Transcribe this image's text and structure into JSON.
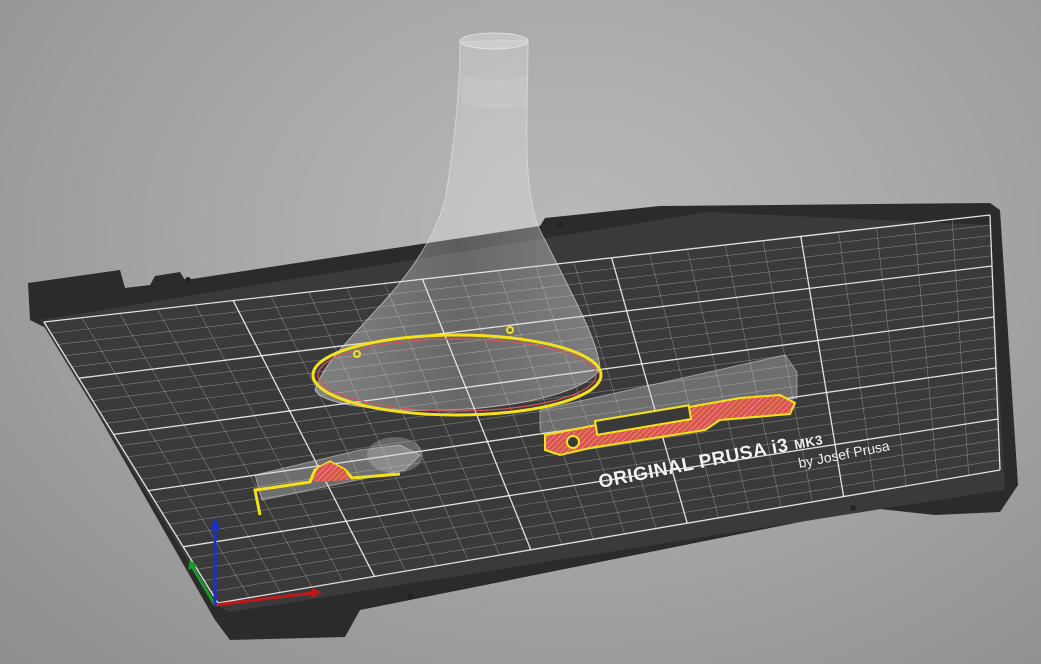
{
  "viewport": {
    "background": [
      "#b9b9b9",
      "#8e8e8e"
    ]
  },
  "bed": {
    "brand": "ORIGINAL PRUSA i3",
    "model": "MK3",
    "maker": "by Josef Prusa",
    "colors": {
      "frame": "#2b2b2b",
      "surface": "#3a3a3a",
      "grid": "#ffffff"
    }
  },
  "objects": [
    {
      "name": "vase",
      "color": "#f3e21a"
    },
    {
      "name": "bar-clip",
      "color": "#f3e21a",
      "fill": "#d9535b"
    },
    {
      "name": "bracket",
      "color": "#f3e21a",
      "fill": "#d9535b"
    }
  ],
  "axes": {
    "x_color": "#c01818",
    "y_color": "#1a9a2a",
    "z_color": "#1a2fd0"
  }
}
